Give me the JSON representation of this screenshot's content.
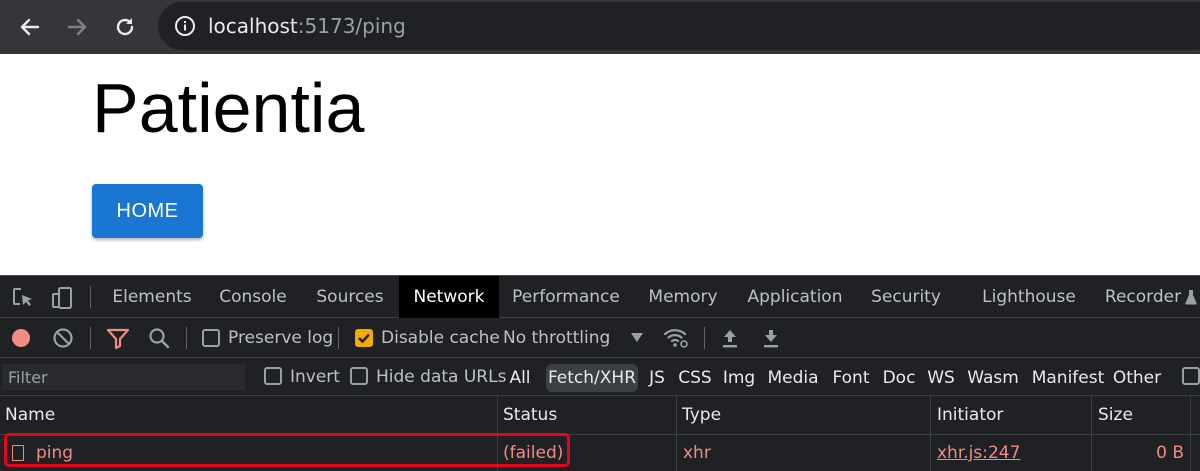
{
  "browser": {
    "url_host": "localhost",
    "url_rest": ":5173/ping",
    "icons": [
      "back-arrow-icon",
      "forward-arrow-icon",
      "reload-icon",
      "info-icon"
    ]
  },
  "page": {
    "title": "Patientia",
    "home_button_label": "HOME",
    "button_color": "#1976d2"
  },
  "devtools": {
    "tabs": [
      "Elements",
      "Console",
      "Sources",
      "Network",
      "Performance",
      "Memory",
      "Application",
      "Security",
      "Lighthouse",
      "Recorder"
    ],
    "active_tab": "Network",
    "toolbar": {
      "preserve_log_label": "Preserve log",
      "preserve_log_checked": false,
      "disable_cache_label": "Disable cache",
      "disable_cache_checked": true,
      "throttling_value": "No throttling"
    },
    "filter": {
      "placeholder": "Filter",
      "invert_label": "Invert",
      "hide_data_urls_label": "Hide data URLs",
      "types": [
        "All",
        "Fetch/XHR",
        "JS",
        "CSS",
        "Img",
        "Media",
        "Font",
        "Doc",
        "WS",
        "Wasm",
        "Manifest",
        "Other"
      ],
      "active_type": "Fetch/XHR"
    },
    "columns": [
      "Name",
      "Status",
      "Type",
      "Initiator",
      "Size"
    ],
    "rows": [
      {
        "name": "ping",
        "status": "(failed)",
        "type": "xhr",
        "initiator": "xhr.js:247",
        "size": "0 B"
      }
    ],
    "colors": {
      "error_text": "#f28b82",
      "highlight_border": "#e0071a",
      "checkbox_checked": "#f2a900"
    }
  }
}
